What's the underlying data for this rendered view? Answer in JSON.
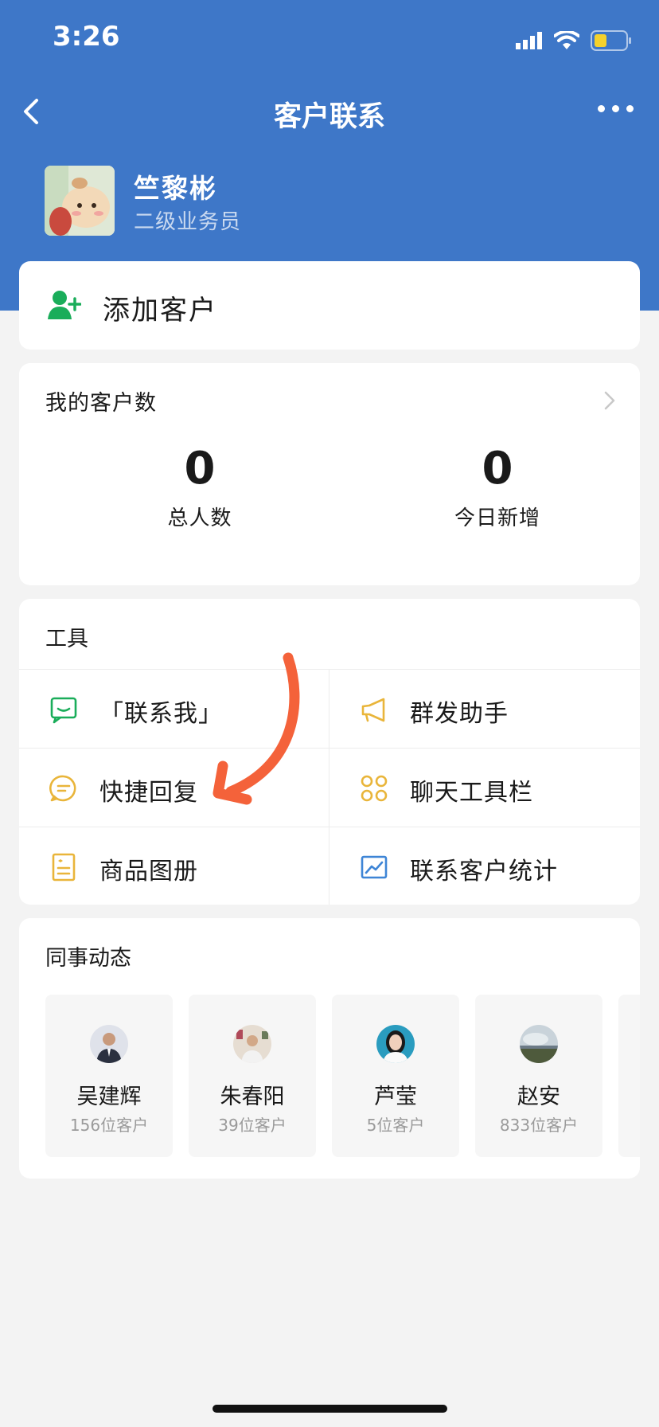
{
  "status": {
    "time": "3:26"
  },
  "nav": {
    "title": "客户联系"
  },
  "profile": {
    "name": "竺黎彬",
    "role": "二级业务员"
  },
  "add_customer": {
    "label": "添加客户"
  },
  "customer_count": {
    "title": "我的客户数",
    "stats": [
      {
        "value": "0",
        "label": "总人数"
      },
      {
        "value": "0",
        "label": "今日新增"
      }
    ]
  },
  "tools": {
    "title": "工具",
    "items": [
      {
        "label": "「联系我」",
        "icon": "contact-me-icon"
      },
      {
        "label": "群发助手",
        "icon": "megaphone-icon"
      },
      {
        "label": "快捷回复",
        "icon": "quick-reply-icon"
      },
      {
        "label": "聊天工具栏",
        "icon": "chat-toolbar-icon"
      },
      {
        "label": "商品图册",
        "icon": "product-album-icon"
      },
      {
        "label": "联系客户统计",
        "icon": "statistics-icon"
      }
    ]
  },
  "colleagues": {
    "title": "同事动态",
    "items": [
      {
        "name": "吴建辉",
        "count": "156位客户"
      },
      {
        "name": "朱春阳",
        "count": "39位客户"
      },
      {
        "name": "芦莹",
        "count": "5位客户"
      },
      {
        "name": "赵安",
        "count": "833位客户"
      }
    ]
  },
  "colors": {
    "header_blue": "#3e77c8",
    "green": "#1aad5a",
    "yellow": "#e9b53a",
    "blue_icon": "#3e85d6",
    "annotation_arrow": "#f4623a"
  }
}
